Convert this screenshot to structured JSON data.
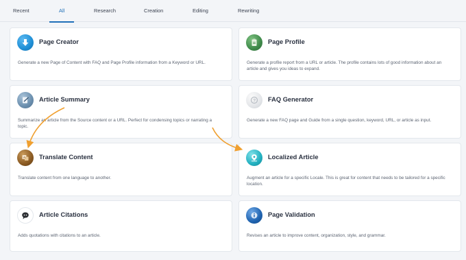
{
  "tabs": [
    {
      "label": "Recent"
    },
    {
      "label": "All",
      "active": true
    },
    {
      "label": "Research"
    },
    {
      "label": "Creation"
    },
    {
      "label": "Editing"
    },
    {
      "label": "Rewriting"
    }
  ],
  "cards": [
    {
      "title": "Page Creator",
      "icon": "download-arrow-icon",
      "description": "Generate a new Page of Content with FAQ and Page Profile information from a Keyword or URL."
    },
    {
      "title": "Page Profile",
      "icon": "clipboard-icon",
      "description": "Generate a profile report from a URL or article. The profile contains lots of good information about an article and gives you ideas to expand."
    },
    {
      "title": "Article Summary",
      "icon": "document-edit-icon",
      "description": "Summarize an article from the Source content or a URL. Perfect for condensing topics or narrating a topic."
    },
    {
      "title": "FAQ Generator",
      "icon": "question-icon",
      "description": "Generate a new FAQ page and Guide from a single question, keyword, URL, or article as input."
    },
    {
      "title": "Translate Content",
      "icon": "translate-icon",
      "description": "Translate content from one language to another."
    },
    {
      "title": "Localized Article",
      "icon": "location-pin-icon",
      "description": "Augment an article for a specific Locale. This is great for content that needs to be tailored for a specific location."
    },
    {
      "title": "Article Citations",
      "icon": "quote-bubble-icon",
      "description": "Adds quotations with citations to an article."
    },
    {
      "title": "Page Validation",
      "icon": "info-icon",
      "description": "Revises an article to improve content, organization, style, and grammar."
    }
  ],
  "colors": {
    "accent": "#1f6fb8",
    "annotation_arrow": "#f0a030",
    "page_creator_icon": "#1f8fd6",
    "page_profile_icon": "#3f8a4a",
    "article_summary_icon": "#6b8fae",
    "faq_generator_icon": "#e4e6e9",
    "translate_icon": "#8a5a22",
    "localized_article_icon": "#22b0c0",
    "citations_icon": "#2c2f33",
    "page_validation_icon": "#1f63b0"
  }
}
